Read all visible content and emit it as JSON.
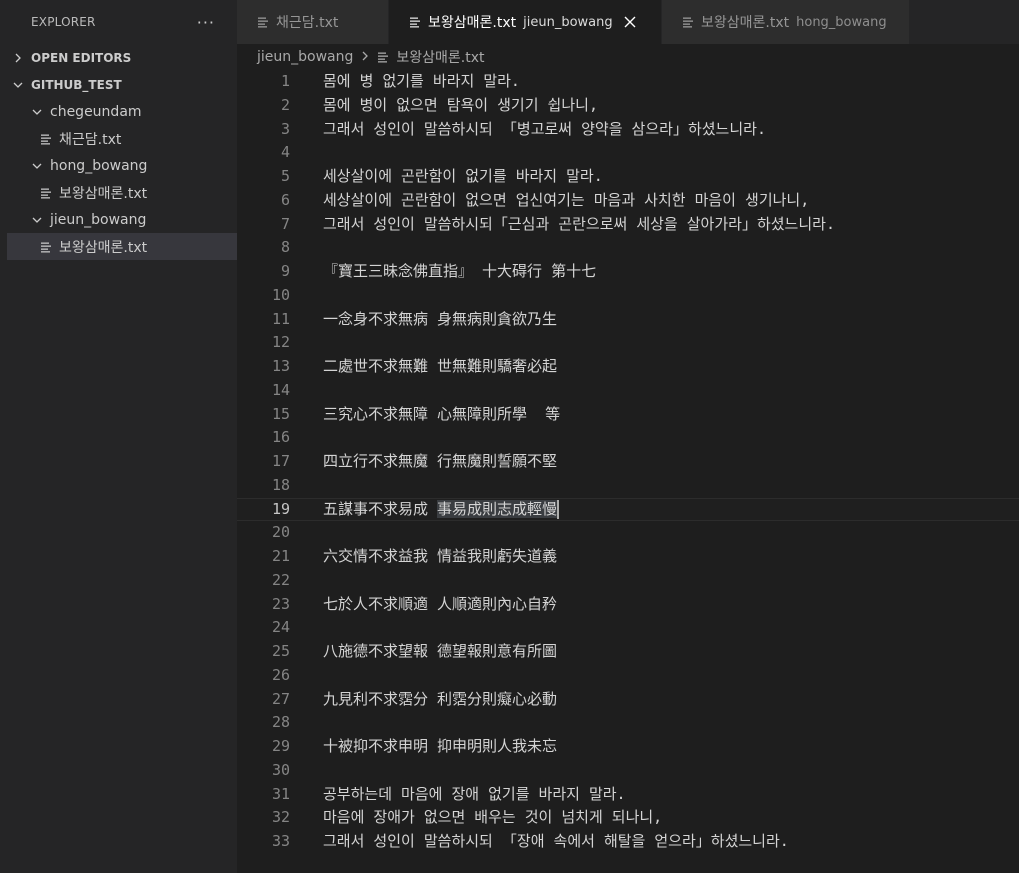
{
  "sidebar": {
    "title": "EXPLORER",
    "more": "···",
    "sections": {
      "open_editors": "OPEN EDITORS",
      "workspace": "GITHUB_TEST"
    },
    "tree": {
      "folder1": "chegeundam",
      "file1": "채근담.txt",
      "folder2": "hong_bowang",
      "file2": "보왕삼매론.txt",
      "folder3": "jieun_bowang",
      "file3": "보왕삼매론.txt"
    }
  },
  "tabs": [
    {
      "label": "채근담.txt",
      "desc": ""
    },
    {
      "label": "보왕삼매론.txt",
      "desc": "jieun_bowang"
    },
    {
      "label": "보왕삼매론.txt",
      "desc": "hong_bowang"
    }
  ],
  "breadcrumb": {
    "folder": "jieun_bowang",
    "file": "보왕삼매론.txt"
  },
  "editor": {
    "current_line": 19,
    "lines": [
      "몸에 병 없기를 바라지 말라.",
      "몸에 병이 없으면 탐욕이 생기기 쉽나니,",
      "그래서 성인이 말씀하시되 「병고로써 양약을 삼으라」하셨느니라.",
      "",
      "세상살이에 곤란함이 없기를 바라지 말라.",
      "세상살이에 곤란함이 없으면 업신여기는 마음과 사치한 마음이 생기나니,",
      "그래서 성인이 말씀하시되「근심과 곤란으로써 세상을 살아가라」하셨느니라.",
      "",
      "『寶王三昧念佛直指』 十大碍行 第十七",
      "",
      "一念身不求無病 身無病則貪欲乃生",
      "",
      "二處世不求無難 世無難則驕奢必起",
      "",
      "三究心不求無障 心無障則所學  等",
      "",
      "四立行不求無魔 行無魔則誓願不堅",
      "",
      "五謀事不求易成 事易成則志成輕慢",
      "",
      "六交情不求益我 情益我則虧失道義",
      "",
      "七於人不求順適 人順適則內心自矜",
      "",
      "八施德不求望報 德望報則意有所圖",
      "",
      "九見利不求霑分 利霑分則癡心必動",
      "",
      "十被抑不求申明 抑申明則人我未忘",
      "",
      "공부하는데 마음에 장애 없기를 바라지 말라.",
      "마음에 장애가 없으면 배우는 것이 넘치게 되나니,",
      "그래서 성인이 말씀하시되 「장애 속에서 해탈을 얻으라」하셨느니라."
    ]
  },
  "colors": {
    "background": "#1e1e1e",
    "sidebar": "#252526",
    "tab_inactive": "#2d2d2d",
    "selection": "#3a3d41"
  }
}
